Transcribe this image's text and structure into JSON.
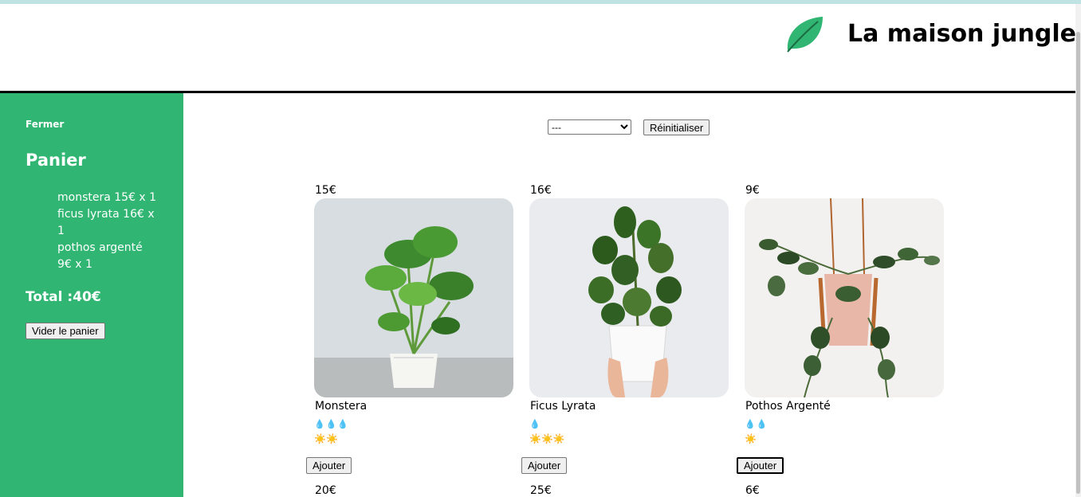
{
  "header": {
    "brand": "La maison jungle",
    "logo_icon": "leaf-icon",
    "colors": {
      "leaf": "#31b572",
      "leaf_vein": "#1a6b42"
    }
  },
  "cart": {
    "close_label": "Fermer",
    "title": "Panier",
    "items": [
      "monstera 15€ x 1",
      "ficus lyrata 16€ x 1",
      "pothos argenté 9€ x 1"
    ],
    "total": "Total :40€",
    "empty_label": "Vider le panier",
    "background": "#31b572"
  },
  "filters": {
    "category_selected": "---",
    "reset_label": "Réinitialiser"
  },
  "plants": [
    {
      "price": "15€",
      "name": "Monstera",
      "water_icons": "💧💧💧",
      "light_icons": "☀️☀️",
      "water": 3,
      "light": 2,
      "add_label": "Ajouter"
    },
    {
      "price": "16€",
      "name": "Ficus Lyrata",
      "water_icons": "💧",
      "light_icons": "☀️☀️☀️",
      "water": 1,
      "light": 3,
      "add_label": "Ajouter"
    },
    {
      "price": "9€",
      "name": "Pothos Argenté",
      "water_icons": "💧💧",
      "light_icons": "☀️",
      "water": 2,
      "light": 1,
      "add_label": "Ajouter"
    }
  ],
  "next_row_prices": [
    "20€",
    "25€",
    "6€"
  ]
}
